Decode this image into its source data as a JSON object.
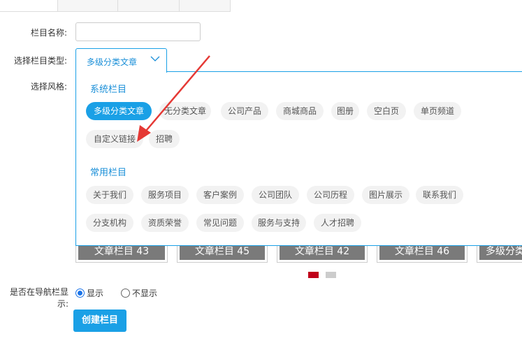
{
  "tabs": [
    {
      "label": ""
    },
    {
      "label": ""
    },
    {
      "label": ""
    },
    {
      "label": ""
    }
  ],
  "form": {
    "name_label": "栏目名称:",
    "name_value": "",
    "type_label": "选择栏目类型:",
    "type_value": "多级分类文章",
    "style_label": "选择风格:",
    "nav_label_line1": "是否在导航栏显",
    "nav_label_line2": "示:",
    "show_label": "显示",
    "hide_label": "不显示",
    "create_button": "创建栏目"
  },
  "dropdown": {
    "system_title": "系统栏目",
    "system_items": [
      "多级分类文章",
      "无分类文章",
      "公司产品",
      "商城商品",
      "图册",
      "空白页",
      "单页频道",
      "自定义链接",
      "招聘"
    ],
    "common_title": "常用栏目",
    "common_items": [
      "关于我们",
      "服务项目",
      "客户案例",
      "公司团队",
      "公司历程",
      "图片展示",
      "联系我们",
      "分支机构",
      "资质荣誉",
      "常见问题",
      "服务与支持",
      "人才招聘"
    ]
  },
  "thumbnails": [
    "文章栏目 43",
    "文章栏目 45",
    "文章栏目 42",
    "文章栏目 46",
    "多级分类"
  ],
  "colors": {
    "accent": "#1aa0e6",
    "arrow": "#e53935",
    "pager_active": "#c0001a",
    "pager_inactive": "#cccccc"
  },
  "pager": {
    "count": 2,
    "active_index": 0
  }
}
